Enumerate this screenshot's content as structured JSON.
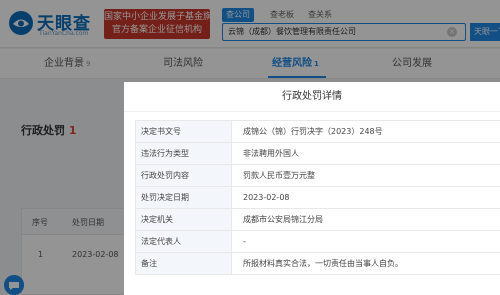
{
  "header": {
    "logo_text": "天眼查",
    "logo_sub": "TianYanCha.com",
    "gov_badge": {
      "line1": "国家中小企业发展子基金旗下",
      "line2": "官方备案企业征信机构"
    },
    "search_tabs": [
      "查公司",
      "查老板",
      "查关系"
    ],
    "search_value": "云锦（成都）餐饮管理有限责任公司",
    "search_button": "天眼一下"
  },
  "nav": {
    "tabs": [
      {
        "label": "企业背景",
        "count": "9"
      },
      {
        "label": "司法风险",
        "count": ""
      },
      {
        "label": "经营风险",
        "count": "1"
      },
      {
        "label": "公司发展",
        "count": ""
      }
    ]
  },
  "page": {
    "section_title": "行政处罚",
    "section_count": "1",
    "table_headers": [
      "序号",
      "处罚日期"
    ],
    "table_row": {
      "index": "1",
      "date": "2023-02-08"
    }
  },
  "modal": {
    "title": "行政处罚详情",
    "rows": [
      {
        "label": "决定书文号",
        "value": "成锦公（锦）行罚决字（2023）248号"
      },
      {
        "label": "违法行为类型",
        "value": "非法聘用外国人"
      },
      {
        "label": "行政处罚内容",
        "value": "罚款人民币壹万元整"
      },
      {
        "label": "处罚决定日期",
        "value": "2023-02-08"
      },
      {
        "label": "决定机关",
        "value": "成都市公安局锦江分局"
      },
      {
        "label": "法定代表人",
        "value": "-"
      },
      {
        "label": "备注",
        "value": "所报材料真实合法，一切责任由当事人自负。"
      }
    ]
  },
  "colors": {
    "brand_blue": "#1e88e5",
    "badge_red": "#c8382c",
    "count_red": "#e5443a"
  },
  "icons": [
    "logo-mark-icon",
    "clear-icon",
    "chat-icon"
  ]
}
